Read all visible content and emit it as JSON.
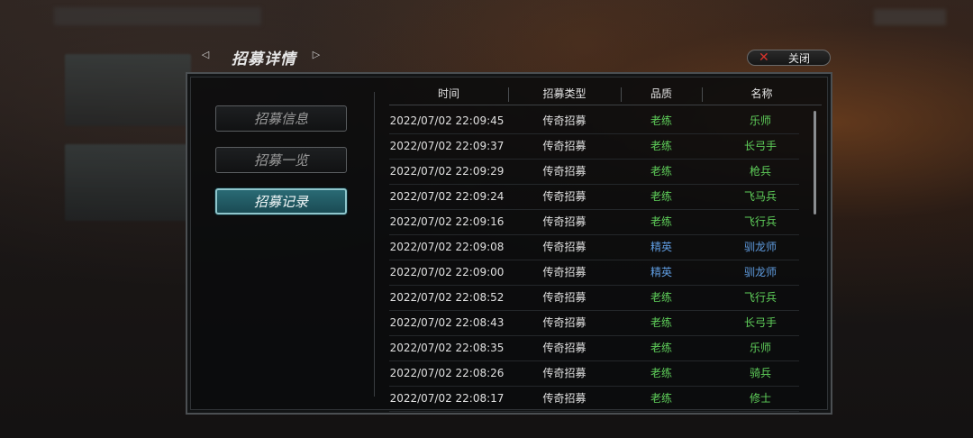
{
  "header": {
    "title": "招募详情",
    "close_label": "关闭"
  },
  "tabs": [
    {
      "label": "招募信息",
      "active": false
    },
    {
      "label": "招募一览",
      "active": false
    },
    {
      "label": "招募记录",
      "active": true
    }
  ],
  "table": {
    "headers": [
      "时间",
      "招募类型",
      "品质",
      "名称"
    ],
    "rows": [
      {
        "time": "2022/07/02  22:09:45",
        "type": "传奇招募",
        "quality": "老练",
        "name": "乐师"
      },
      {
        "time": "2022/07/02  22:09:37",
        "type": "传奇招募",
        "quality": "老练",
        "name": "长弓手"
      },
      {
        "time": "2022/07/02  22:09:29",
        "type": "传奇招募",
        "quality": "老练",
        "name": "枪兵"
      },
      {
        "time": "2022/07/02  22:09:24",
        "type": "传奇招募",
        "quality": "老练",
        "name": "飞马兵"
      },
      {
        "time": "2022/07/02  22:09:16",
        "type": "传奇招募",
        "quality": "老练",
        "name": "飞行兵"
      },
      {
        "time": "2022/07/02  22:09:08",
        "type": "传奇招募",
        "quality": "精英",
        "name": "驯龙师"
      },
      {
        "time": "2022/07/02  22:09:00",
        "type": "传奇招募",
        "quality": "精英",
        "name": "驯龙师"
      },
      {
        "time": "2022/07/02  22:08:52",
        "type": "传奇招募",
        "quality": "老练",
        "name": "飞行兵"
      },
      {
        "time": "2022/07/02  22:08:43",
        "type": "传奇招募",
        "quality": "老练",
        "name": "长弓手"
      },
      {
        "time": "2022/07/02  22:08:35",
        "type": "传奇招募",
        "quality": "老练",
        "name": "乐师"
      },
      {
        "time": "2022/07/02  22:08:26",
        "type": "传奇招募",
        "quality": "老练",
        "name": "骑兵"
      },
      {
        "time": "2022/07/02  22:08:17",
        "type": "传奇招募",
        "quality": "老练",
        "name": "修士"
      }
    ]
  },
  "colors": {
    "quality_veteran": "#5fcf5a",
    "quality_elite": "#5f9ce0",
    "accent": "#2a6a74",
    "close_icon": "#d8342c"
  },
  "icons": {
    "prev": "nav-prev-icon",
    "next": "nav-next-icon",
    "close": "close-icon"
  }
}
